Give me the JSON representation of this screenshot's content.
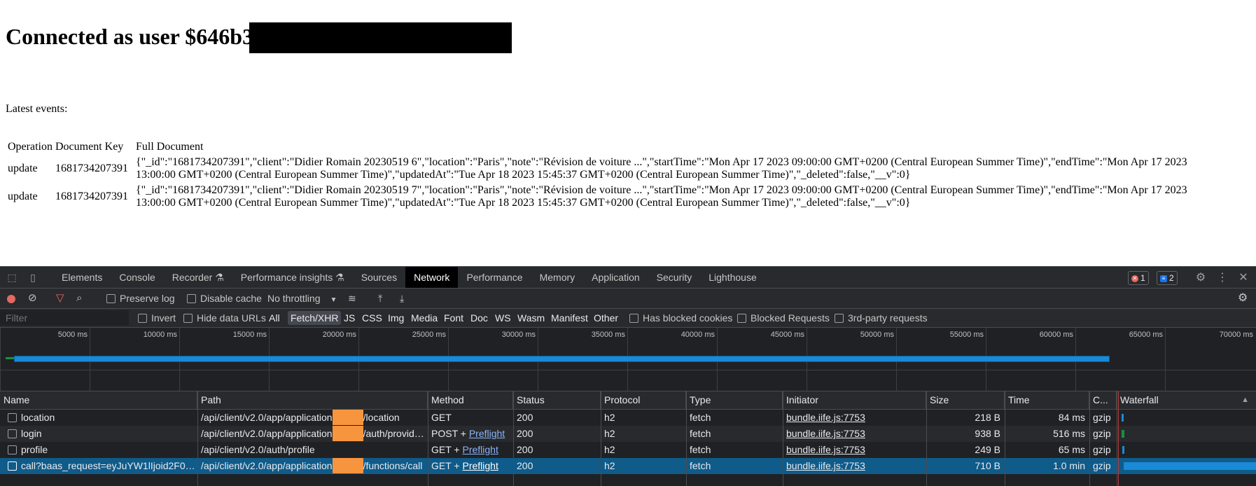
{
  "page": {
    "title": "Connected as user $646b3",
    "latest_label": "Latest events:",
    "table": {
      "headers": [
        "Operation",
        "Document Key",
        "Full Document"
      ],
      "rows": [
        {
          "operation": "update",
          "key": "1681734207391",
          "doc": "{\"_id\":\"1681734207391\",\"client\":\"Didier Romain 20230519 6\",\"location\":\"Paris\",\"note\":\"Révision de voiture ...\",\"startTime\":\"Mon Apr 17 2023 09:00:00 GMT+0200 (Central European Summer Time)\",\"endTime\":\"Mon Apr 17 2023 13:00:00 GMT+0200 (Central European Summer Time)\",\"updatedAt\":\"Tue Apr 18 2023 15:45:37 GMT+0200 (Central European Summer Time)\",\"_deleted\":false,\"__v\":0}"
        },
        {
          "operation": "update",
          "key": "1681734207391",
          "doc": "{\"_id\":\"1681734207391\",\"client\":\"Didier Romain 20230519 7\",\"location\":\"Paris\",\"note\":\"Révision de voiture ...\",\"startTime\":\"Mon Apr 17 2023 09:00:00 GMT+0200 (Central European Summer Time)\",\"endTime\":\"Mon Apr 17 2023 13:00:00 GMT+0200 (Central European Summer Time)\",\"updatedAt\":\"Tue Apr 18 2023 15:45:37 GMT+0200 (Central European Summer Time)\",\"_deleted\":false,\"__v\":0}"
        }
      ]
    }
  },
  "devtools": {
    "tabs": [
      "Elements",
      "Console",
      "Recorder ⚗",
      "Performance insights ⚗",
      "Sources",
      "Network",
      "Performance",
      "Memory",
      "Application",
      "Security",
      "Lighthouse"
    ],
    "active_tab": "Network",
    "errors_count": "1",
    "messages_count": "2",
    "toolbar": {
      "preserve_log": "Preserve log",
      "disable_cache": "Disable cache",
      "throttling": "No throttling"
    },
    "filter": {
      "placeholder": "Filter",
      "invert": "Invert",
      "hide_data_urls": "Hide data URLs",
      "types": [
        "All",
        "Fetch/XHR",
        "JS",
        "CSS",
        "Img",
        "Media",
        "Font",
        "Doc",
        "WS",
        "Wasm",
        "Manifest",
        "Other"
      ],
      "selected_type": "Fetch/XHR",
      "has_blocked_cookies": "Has blocked cookies",
      "blocked_requests": "Blocked Requests",
      "third_party": "3rd-party requests"
    },
    "timeline_ticks": [
      "5000 ms",
      "10000 ms",
      "15000 ms",
      "20000 ms",
      "25000 ms",
      "30000 ms",
      "35000 ms",
      "40000 ms",
      "45000 ms",
      "50000 ms",
      "55000 ms",
      "60000 ms",
      "65000 ms",
      "70000 ms"
    ],
    "columns": [
      "Name",
      "Path",
      "Method",
      "Status",
      "Protocol",
      "Type",
      "Initiator",
      "Size",
      "Time",
      "C...",
      "Waterfall"
    ],
    "requests": [
      {
        "name": "location",
        "path_a": "/api/client/v2.0/app/application",
        "path_b": "/location",
        "method": "GET",
        "preflight": "",
        "status": "200",
        "protocol": "h2",
        "type": "fetch",
        "initiator": "bundle.iife.js:7753",
        "size": "218 B",
        "time": "84 ms",
        "content": "gzip"
      },
      {
        "name": "login",
        "path_a": "/api/client/v2.0/app/application",
        "path_b": "/auth/provide…",
        "method": "POST + ",
        "preflight": "Preflight",
        "status": "200",
        "protocol": "h2",
        "type": "fetch",
        "initiator": "bundle.iife.js:7753",
        "size": "938 B",
        "time": "516 ms",
        "content": "gzip"
      },
      {
        "name": "profile",
        "path_a": "/api/client/v2.0/auth/profile",
        "path_b": "",
        "method": "GET + ",
        "preflight": "Preflight",
        "status": "200",
        "protocol": "h2",
        "type": "fetch",
        "initiator": "bundle.iife.js:7753",
        "size": "249 B",
        "time": "65 ms",
        "content": "gzip"
      },
      {
        "name": "call?baas_request=eyJuYW1lIjoid2F0Y…",
        "path_a": "/api/client/v2.0/app/application",
        "path_b": "/functions/call",
        "method": "GET + ",
        "preflight": "Preflight",
        "status": "200",
        "protocol": "h2",
        "type": "fetch",
        "initiator": "bundle.iife.js:7753",
        "size": "710 B",
        "time": "1.0 min",
        "content": "gzip"
      }
    ]
  }
}
